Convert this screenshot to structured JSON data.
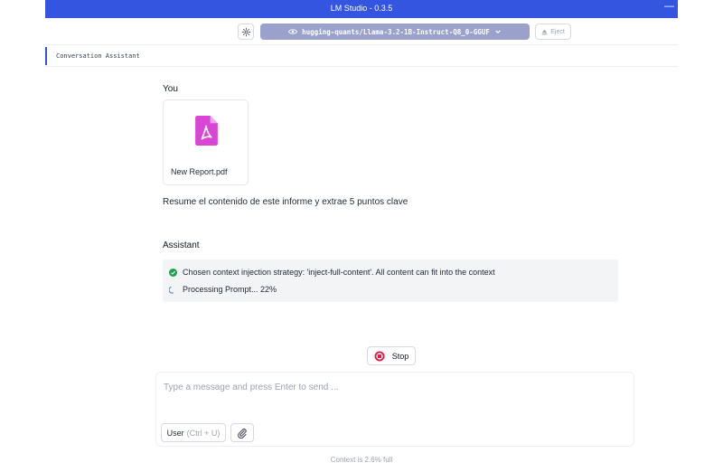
{
  "app": {
    "title": "LM Studio - 0.3.5",
    "minimize": "—"
  },
  "toolbar": {
    "model": "hugging-quants/Llama-3.2-1B-Instruct-Q8_0-GGUF",
    "eject_label": "Eject"
  },
  "header": {
    "tab_label": "Conversation Assistant"
  },
  "chat": {
    "user_role": "You",
    "attachment_name": "New Report.pdf",
    "user_message": "Resume el contenido de este informe y extrae 5 puntos clave",
    "assistant_role": "Assistant",
    "status_strategy": "Chosen context injection strategy: 'inject-full-content'. All content can fit into the context",
    "status_processing": "Processing Prompt... 22%",
    "progress_percent": 22
  },
  "controls": {
    "stop_label": "Stop"
  },
  "composer": {
    "placeholder": "Type a message and press Enter to send ...",
    "role_label": "User",
    "role_shortcut": "(Ctrl + U)"
  },
  "footer": {
    "context_text": "Context is 2.6% full"
  },
  "colors": {
    "titlebar": "#3355e0",
    "model_button": "#9aa2cc",
    "pdf_icon": "#d946d6",
    "success": "#16a34a",
    "stop": "#e11d48"
  },
  "icons": {
    "settings": "gear-icon",
    "model": "eye-icon",
    "dropdown": "chevron-down-icon",
    "eject": "eject-icon",
    "file": "pdf-icon",
    "success": "check-circle-icon",
    "loading": "spinner-icon",
    "stop": "stop-icon",
    "attach": "paperclip-icon"
  }
}
